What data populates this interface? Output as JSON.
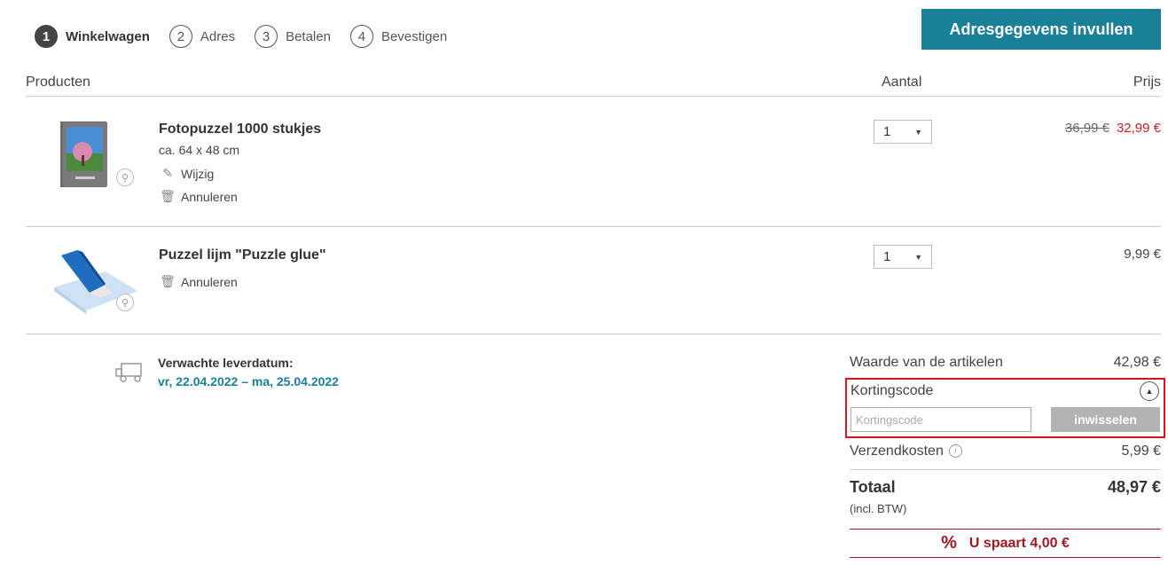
{
  "steps": [
    {
      "num": "1",
      "label": "Winkelwagen"
    },
    {
      "num": "2",
      "label": "Adres"
    },
    {
      "num": "3",
      "label": "Betalen"
    },
    {
      "num": "4",
      "label": "Bevestigen"
    }
  ],
  "cta_label": "Adresgegevens invullen",
  "table": {
    "col_products": "Producten",
    "col_quantity": "Aantal",
    "col_price": "Prijs"
  },
  "products": [
    {
      "name": "Fotopuzzel 1000 stukjes",
      "size": "ca. 64 x 48 cm",
      "edit_label": "Wijzig",
      "cancel_label": "Annuleren",
      "quantity": "1",
      "old_price": "36,99 €",
      "price": "32,99 €"
    },
    {
      "name": "Puzzel lijm \"Puzzle glue\"",
      "cancel_label": "Annuleren",
      "quantity": "1",
      "price": "9,99 €"
    }
  ],
  "delivery": {
    "label": "Verwachte leverdatum:",
    "date": "vr, 22.04.2022 – ma, 25.04.2022"
  },
  "summary": {
    "items_label": "Waarde van de artikelen",
    "items_value": "42,98 €",
    "coupon_title": "Kortingscode",
    "coupon_placeholder": "Kortingscode",
    "coupon_button": "inwisselen",
    "shipping_label": "Verzendkosten",
    "shipping_value": "5,99 €",
    "total_label": "Totaal",
    "total_value": "48,97 €",
    "vat_note": "(incl. BTW)",
    "savings": "U spaart 4,00 €"
  },
  "colors": {
    "accent": "#1a7f98",
    "sale": "#c0262c",
    "highlight": "#d9151d",
    "savings": "#a01820"
  }
}
